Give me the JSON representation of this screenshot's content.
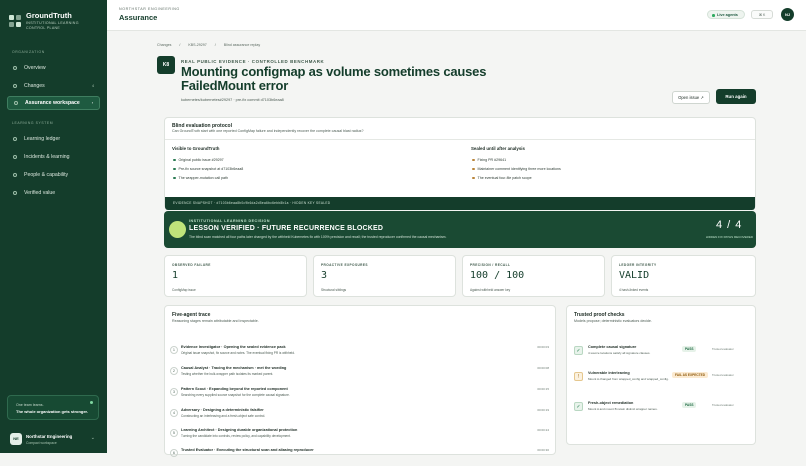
{
  "brand": {
    "title": "GroundTruth",
    "subtitle": "INSTITUTIONAL LEARNING CONTROL PLANE"
  },
  "sidebar": {
    "sec_org": "ORGANIZATION",
    "sec_learn": "LEARNING SYSTEM",
    "items": [
      {
        "label": "Overview"
      },
      {
        "label": "Changes",
        "count": "4"
      },
      {
        "label": "Assurance workspace"
      },
      {
        "label": "Learning ledger"
      },
      {
        "label": "Incidents & learning"
      },
      {
        "label": "People & capability"
      },
      {
        "label": "Verified value"
      }
    ],
    "promo": {
      "line1": "One team learns.",
      "line2": "The whole organization gets stronger."
    },
    "account": {
      "initials": "NE",
      "name": "Northstar Engineering",
      "sub": "Compact workspace"
    }
  },
  "topbar": {
    "kicker": "NORTHSTAR ENGINEERING",
    "title": "Assurance",
    "live": "Live agents",
    "kbd": "⌘ K",
    "user": "NJ"
  },
  "crumbs": [
    "Changes",
    "/",
    "KBS-29297",
    "/",
    "Blind assurance replay"
  ],
  "header": {
    "badge": "K8",
    "kicker": "REAL PUBLIC EVIDENCE · CONTROLLED BENCHMARK",
    "title": "Mounting configmap as volume sometimes causes FailedMount error",
    "sub": "kubernetes/kubernetes#29297 · pre-fix commit d7103b6eaa8",
    "open_issue": "Open issue ↗",
    "run_again": "Run again"
  },
  "protocol": {
    "title": "Blind evaluation protocol",
    "sub": "Can GroundTruth start with one reported ConfigMap failure and independently recover the complete causal blast radius?",
    "visible_head": "Visible to GroundTruth",
    "visible": [
      "Original public issue #29297",
      "Pre-fix source snapshot at d7103b6eaa8",
      "The wrapper-mutation call path"
    ],
    "sealed_head": "Sealed until after analysis",
    "sealed": [
      "Fixing PR #29641",
      "Maintainer comment identifying three more locations",
      "The eventual four-file patch scope"
    ],
    "footer": "EVIDENCE SNAPSHOT · d7103b6eaa8b0c9b6da2d5ea6bc6ebb8b1a · HIDDEN KEY SEALED"
  },
  "decision": {
    "kicker": "INSTITUTIONAL LEARNING DECISION",
    "title": "LESSON VERIFIED · FUTURE RECURRENCE BLOCKED",
    "sub": "The blind scan matched all four paths later changed by the withheld Kubernetes fix with 100% precision and recall; the trusted reproducer confirmed the causal mechanism.",
    "score": "4 / 4",
    "score_label": "HIDDEN FIX PATHS RECOVERED"
  },
  "stats": [
    {
      "label": "OBSERVED FAILURE",
      "value": "1",
      "sub": "ConfigMap issue"
    },
    {
      "label": "PROACTIVE EXPOSURES",
      "value": "3",
      "sub": "Structural siblings"
    },
    {
      "label": "PRECISION / RECALL",
      "value": "100 / 100",
      "sub": "Against withheld answer key"
    },
    {
      "label": "LEDGER INTEGRITY",
      "value": "VALID",
      "sub": "4 hash-linked events"
    }
  ],
  "trace": {
    "title": "Five-agent trace",
    "sub": "Reasoning stages remain attributable and inspectable.",
    "steps": [
      {
        "n": "1",
        "a": "Evidence Investigator · Opening the sealed evidence pack",
        "b": "Original issue snapshot, fix source and notes. The eventual fixing PR is withheld.",
        "ms": "00:00:03"
      },
      {
        "n": "2",
        "a": "Causal Analyst · Tracing the mechanism · met the wording",
        "b": "Testing whether the bulk-wrapper path isolates its marked parent.",
        "ms": "00:00:08"
      },
      {
        "n": "3",
        "a": "Pattern Scout · Expanding beyond the reported component",
        "b": "Searching every supplied source snapshot for the complete causal signature.",
        "ms": "00:00:15"
      },
      {
        "n": "4",
        "a": "Adversary · Designing a deterministic falsifier",
        "b": "Constructing an interleaving and a fresh-object safe control.",
        "ms": "00:00:19"
      },
      {
        "n": "5",
        "a": "Learning Architect · Designing durable organizational protection",
        "b": "Turning the candidate into controls, review policy, and capability development.",
        "ms": "00:00:24"
      },
      {
        "n": "6",
        "a": "Trusted Evaluator · Executing the structural scan and aliasing reproducer",
        "b": "",
        "ms": "00:00:30"
      }
    ]
  },
  "checks": {
    "title": "Trusted proof checks",
    "sub": "Models propose; deterministic evaluators decide.",
    "items": [
      {
        "icon": "✓",
        "kind": "pass",
        "a": "Complete causal signature",
        "b": "4 source locations satisfy all signature clauses.",
        "badge": "PASS",
        "ev": "Trusted evaluator"
      },
      {
        "icon": "!",
        "kind": "fail",
        "a": "Vulnerable interleaving",
        "b": "Mount A changed from wrapped_config and wrapped_config.",
        "badge": "FAIL AS EXPECTED",
        "ev": "Trusted evaluator"
      },
      {
        "icon": "✓",
        "kind": "pass",
        "a": "Fresh-object remediation",
        "b": "Mount A and mount B retain distinct wrapper names.",
        "badge": "PASS",
        "ev": "Trusted evaluator"
      }
    ]
  },
  "colors": {
    "brand": "#143d2b",
    "accent": "#bfe37a",
    "pass": "#1e6a43",
    "warn": "#8f5a0c"
  }
}
